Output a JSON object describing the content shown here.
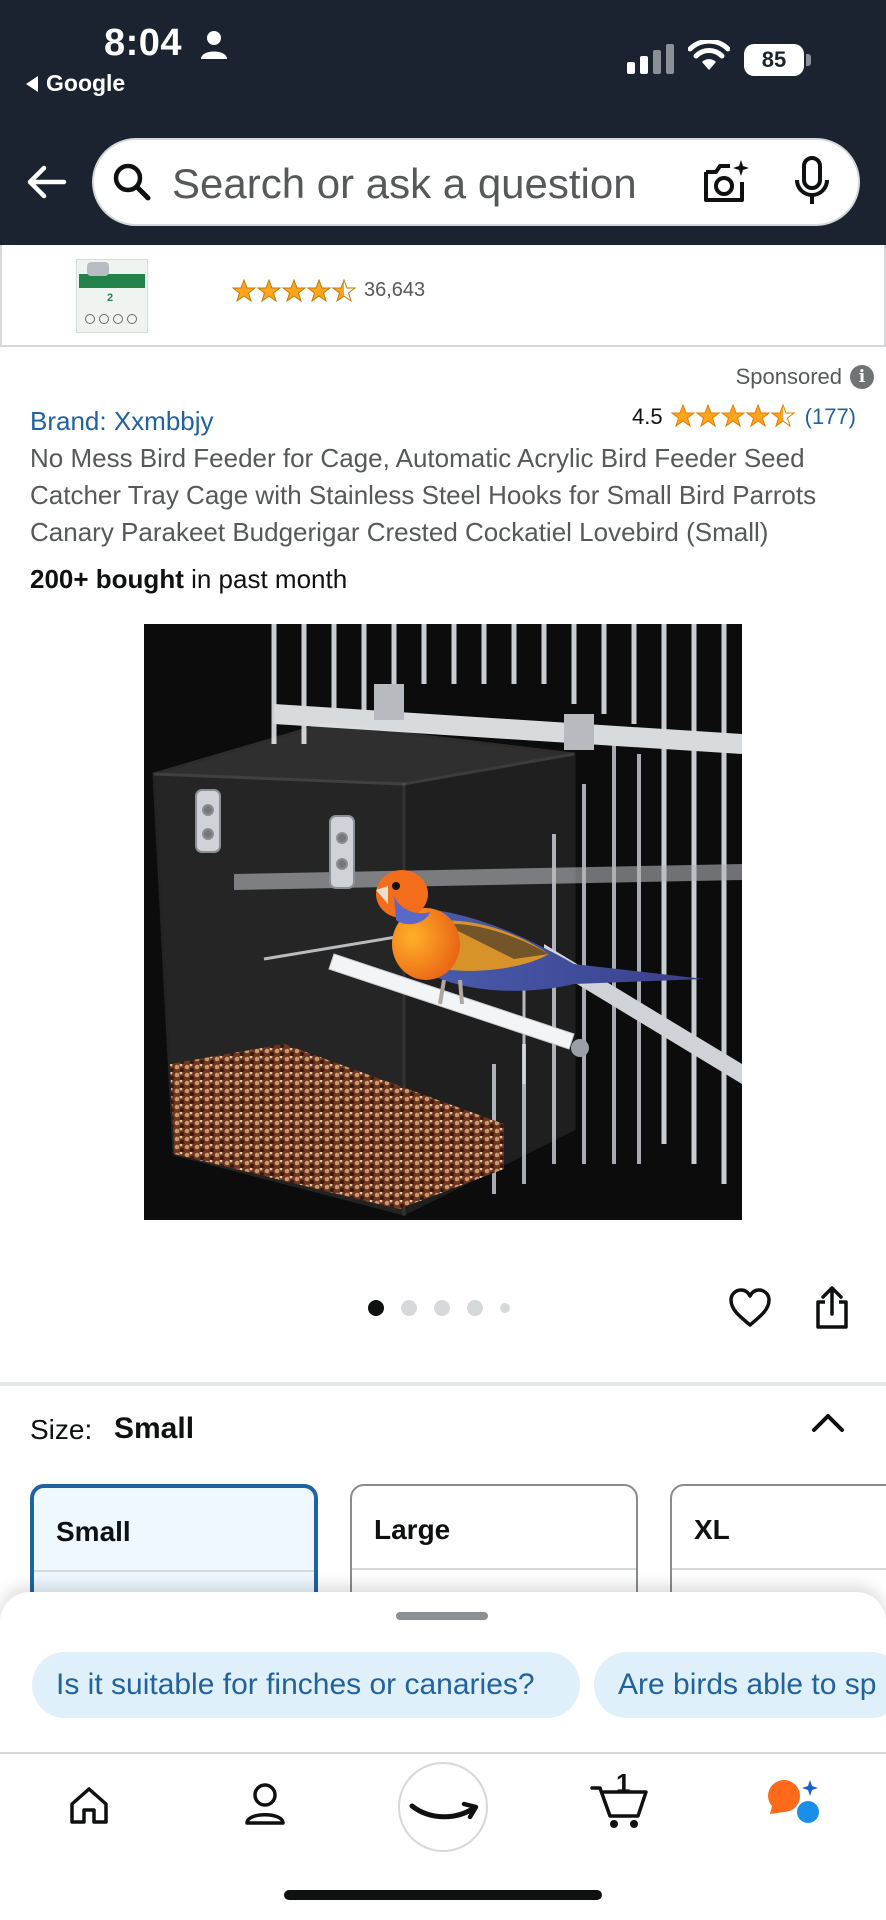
{
  "status_bar": {
    "time": "8:04",
    "back_app": "Google",
    "battery": "85"
  },
  "search": {
    "placeholder": "Search or ask a question"
  },
  "sponsored_strip": {
    "rating_count": "36,643",
    "thumb_number": "2"
  },
  "product": {
    "sponsored_label": "Sponsored",
    "info_icon": "i",
    "brand": "Brand: Xxmbbjy",
    "rating_value": "4.5",
    "rating_stars": 4.5,
    "rating_count": "(177)",
    "title": "No Mess Bird Feeder for Cage, Automatic Acrylic Bird Feeder Seed Catcher Tray Cage with Stainless Steel Hooks for Small Bird Parrots Canary Parakeet Budgerigar Crested Cockatiel Lovebird (Small)",
    "bought_bold": "200+ bought",
    "bought_rest": " in past month"
  },
  "gallery": {
    "image_count": 5,
    "active_index": 0
  },
  "size": {
    "label": "Size:",
    "value": "Small",
    "options": [
      "Small",
      "Large",
      "XL"
    ],
    "selected": "Small"
  },
  "questions": [
    "Is it suitable for finches or canaries?",
    "Are birds able to sp"
  ],
  "tabbar": {
    "cart_count": "1",
    "items": [
      "home-icon",
      "account-icon",
      "amazon-smile-icon",
      "cart-icon",
      "rufus-icon"
    ]
  },
  "colors": {
    "header": "#1b2230",
    "link": "#2162a1",
    "star": "#ffa41c",
    "selected_bg": "#edf8ff",
    "chip_bg": "#dff0fb"
  }
}
